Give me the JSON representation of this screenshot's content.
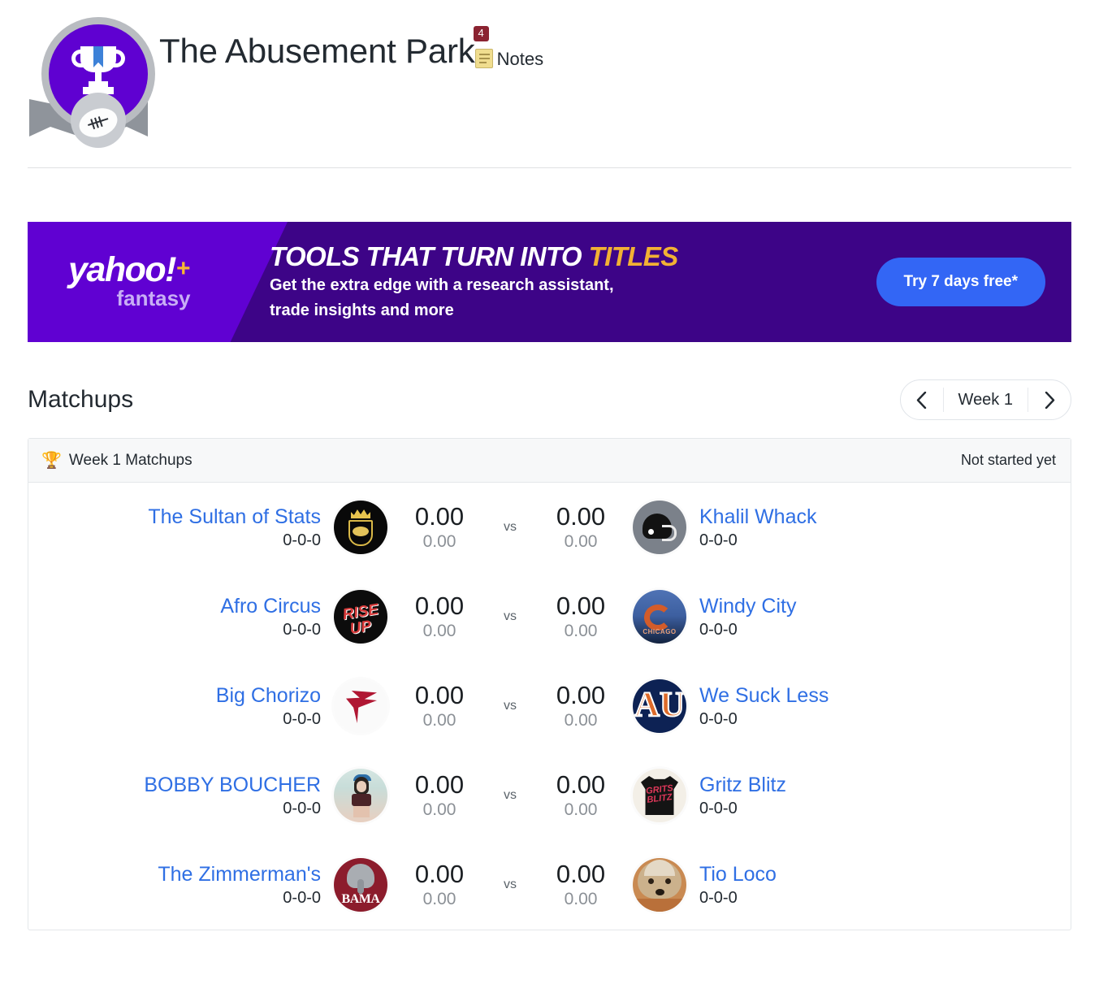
{
  "header": {
    "league_name": "The Abusement Park",
    "notes_label": "Notes",
    "notes_count": "4",
    "badge_icon": "trophy-badge-icon"
  },
  "ad": {
    "brand": "yahoo!",
    "brand_plus": "+",
    "brand_sub": "fantasy",
    "headline_1": "TOOLS THAT TURN INTO ",
    "headline_accent": "TITLES",
    "sub_line_1": "Get the extra edge with a research assistant,",
    "sub_line_2": "trade insights and more",
    "cta": "Try 7 days free*",
    "colors": {
      "left_panel": "#6001d2",
      "right_panel": "#3d0487",
      "accent": "#f2b134",
      "cta_bg": "#3366f5"
    }
  },
  "matchups": {
    "section_title": "Matchups",
    "week_selector": {
      "prev_icon": "chevron-left-icon",
      "label": "Week 1",
      "next_icon": "chevron-right-icon"
    },
    "card_header": {
      "icon": "trophy-icon",
      "title": "Week 1 Matchups",
      "status": "Not started yet"
    },
    "vs_label": "vs",
    "rows": [
      {
        "left": {
          "name": "The Sultan of Stats",
          "record": "0-0-0",
          "score": "0.00",
          "projected": "0.00",
          "avatar": "sultan-crown-shield-avatar"
        },
        "right": {
          "name": "Khalil Whack",
          "record": "0-0-0",
          "score": "0.00",
          "projected": "0.00",
          "avatar": "football-helmet-avatar"
        }
      },
      {
        "left": {
          "name": "Afro Circus",
          "record": "0-0-0",
          "score": "0.00",
          "projected": "0.00",
          "avatar": "rise-up-avatar"
        },
        "right": {
          "name": "Windy City",
          "record": "0-0-0",
          "score": "0.00",
          "projected": "0.00",
          "avatar": "chicago-bears-avatar"
        }
      },
      {
        "left": {
          "name": "Big Chorizo",
          "record": "0-0-0",
          "score": "0.00",
          "projected": "0.00",
          "avatar": "atlanta-falcons-avatar"
        },
        "right": {
          "name": "We Suck Less",
          "record": "0-0-0",
          "score": "0.00",
          "projected": "0.00",
          "avatar": "auburn-tigers-avatar"
        }
      },
      {
        "left": {
          "name": "BOBBY BOUCHER",
          "record": "0-0-0",
          "score": "0.00",
          "projected": "0.00",
          "avatar": "person-photo-avatar"
        },
        "right": {
          "name": "Gritz Blitz",
          "record": "0-0-0",
          "score": "0.00",
          "projected": "0.00",
          "avatar": "grits-blitz-shirt-avatar"
        }
      },
      {
        "left": {
          "name": "The Zimmerman's",
          "record": "0-0-0",
          "score": "0.00",
          "projected": "0.00",
          "avatar": "alabama-crimson-tide-avatar"
        },
        "right": {
          "name": "Tio Loco",
          "record": "0-0-0",
          "score": "0.00",
          "projected": "0.00",
          "avatar": "dog-photo-avatar"
        }
      }
    ],
    "rise_up_text": {
      "line1": "RISE",
      "line2": "UP"
    },
    "bears_text": "CHICAGO",
    "auburn_text": "AU",
    "shirt_text": {
      "line1": "GRITS",
      "line2": "BLITZ"
    },
    "alabama_text": "BAMA"
  }
}
